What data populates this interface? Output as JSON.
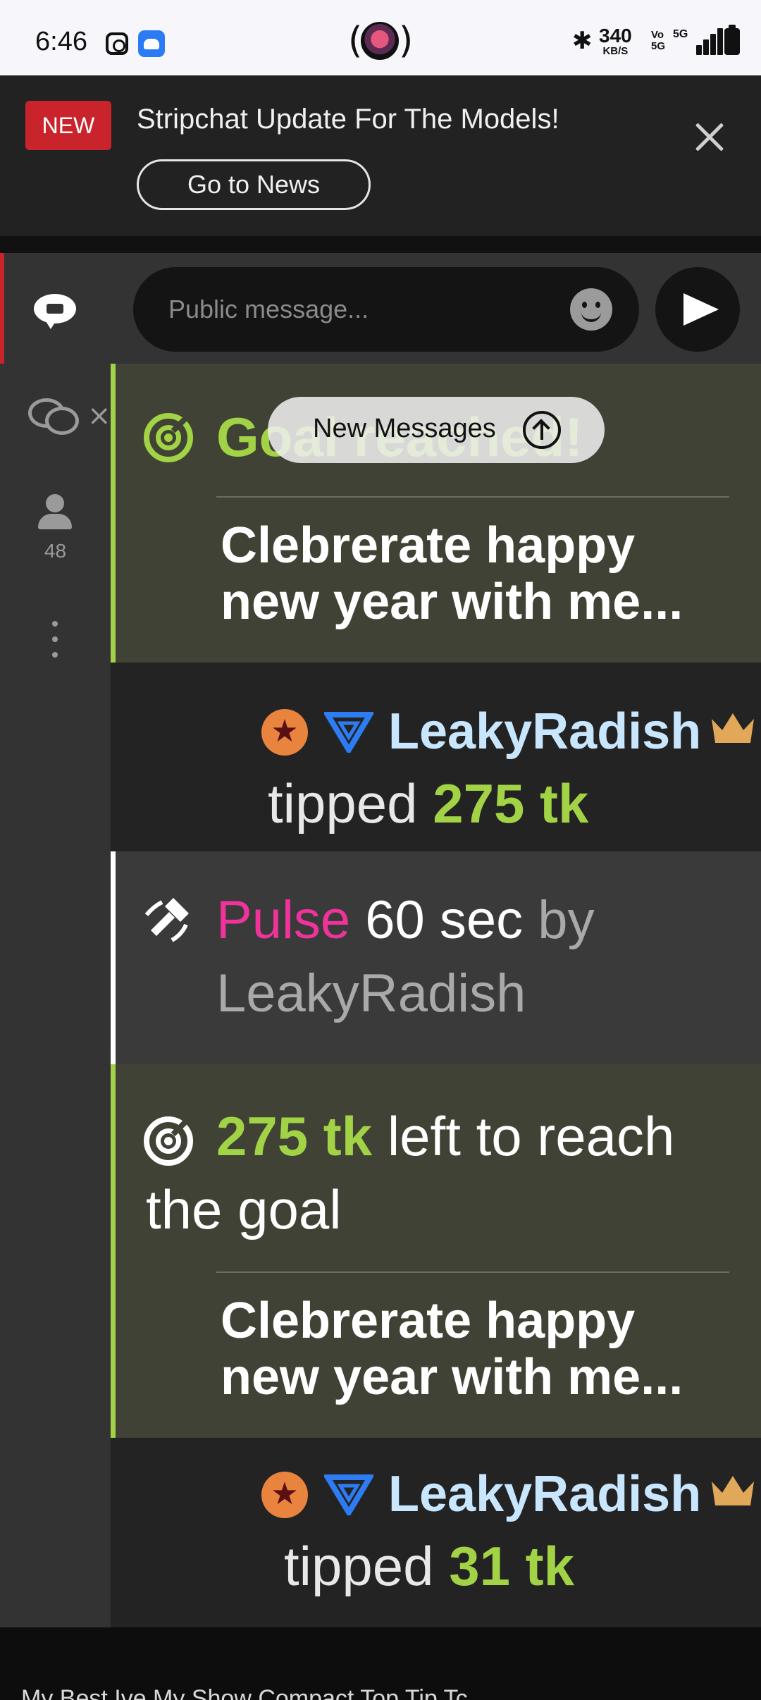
{
  "status_bar": {
    "time": "6:46",
    "speed_value": "340",
    "speed_unit": "KB/S",
    "volte": "Vo\n5G",
    "network": "5G"
  },
  "news_banner": {
    "badge": "NEW",
    "title": "Stripchat Update For The Models!",
    "button": "Go to News"
  },
  "sidebar": {
    "users_count": "48"
  },
  "composer": {
    "placeholder": "Public message..."
  },
  "new_messages_pill": {
    "label": "New Messages"
  },
  "messages": {
    "goal_reached": {
      "title": "Goal reached!",
      "description": "Clebrerate happy new year with me..."
    },
    "tip1": {
      "username": "LeakyRadish",
      "verb": "tipped",
      "amount": "275 tk"
    },
    "pulse": {
      "kind": "Pulse",
      "duration": "60 sec",
      "by": "by",
      "username": "LeakyRadish"
    },
    "goal_left": {
      "amount": "275 tk",
      "text": "left to reach the goal",
      "description": "Clebrerate happy new year with me..."
    },
    "tip2": {
      "username": "LeakyRadish",
      "verb": "tipped",
      "amount": "31 tk"
    }
  },
  "bottom_nav": {
    "text": "My Best Ive   My Show   Compact   Top   Tip   Tc"
  },
  "colors": {
    "accent_green": "#a2d245",
    "pulse_pink": "#f0339b",
    "news_red": "#c9232c",
    "username_blue": "#c9e6ff",
    "badge_orange": "#e9843f",
    "crown_gold": "#e2a85a"
  },
  "icons": {
    "chat": "public-chat-icon",
    "private": "private-chat-icon",
    "users": "users-icon",
    "more": "more-vertical-icon",
    "send": "send-icon",
    "emoji": "emoji-icon",
    "goal": "target-icon",
    "pulse": "pulse-icon",
    "close": "close-icon"
  }
}
